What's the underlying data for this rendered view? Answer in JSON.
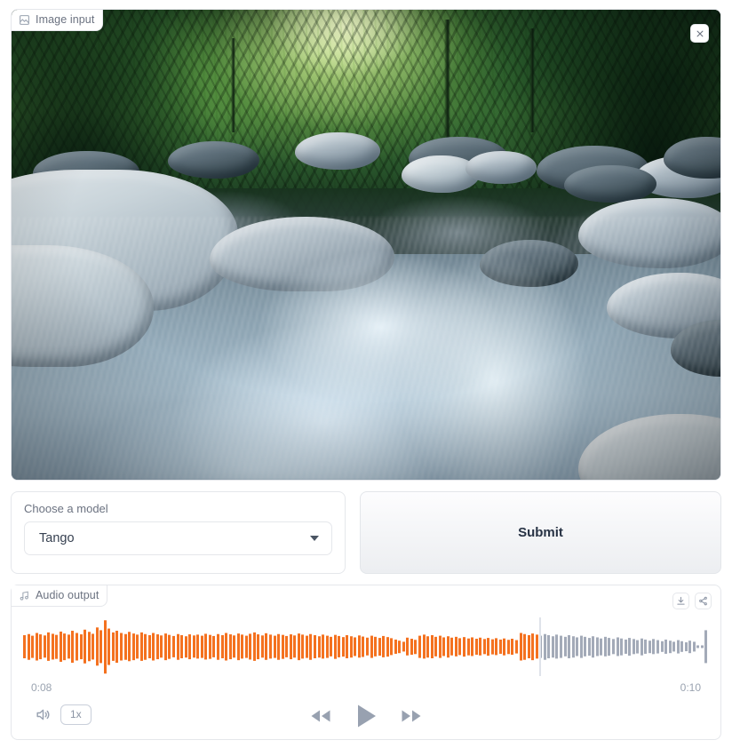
{
  "image_input": {
    "label": "Image input",
    "icon": "image-icon",
    "close_icon": "close-icon",
    "photo_description": "Long-exposure photograph of a mountain stream flowing over blue-gray boulders with a bright green forest canopy above"
  },
  "model_selector": {
    "label": "Choose a model",
    "value": "Tango",
    "caret_icon": "chevron-down-icon"
  },
  "submit": {
    "label": "Submit"
  },
  "audio_output": {
    "label": "Audio output",
    "icon": "music-note-icon",
    "download_icon": "download-icon",
    "share_icon": "share-icon",
    "current_time": "0:08",
    "total_time": "0:10",
    "volume_icon": "volume-icon",
    "speed_label": "1x",
    "rewind_icon": "rewind-icon",
    "play_icon": "play-icon",
    "forward_icon": "fast-forward-icon",
    "progress_ratio": 0.755,
    "played_color": "#f4711f",
    "remaining_color": "#a3aab8",
    "playhead_color": "#dfe3ea",
    "waveform_heights": [
      0.42,
      0.46,
      0.4,
      0.5,
      0.45,
      0.41,
      0.52,
      0.47,
      0.43,
      0.55,
      0.48,
      0.44,
      0.58,
      0.5,
      0.45,
      0.62,
      0.54,
      0.47,
      0.7,
      0.6,
      0.96,
      0.66,
      0.52,
      0.58,
      0.5,
      0.46,
      0.54,
      0.48,
      0.44,
      0.52,
      0.46,
      0.42,
      0.5,
      0.45,
      0.41,
      0.48,
      0.43,
      0.39,
      0.46,
      0.42,
      0.38,
      0.45,
      0.41,
      0.44,
      0.4,
      0.47,
      0.43,
      0.39,
      0.46,
      0.42,
      0.5,
      0.45,
      0.41,
      0.48,
      0.44,
      0.4,
      0.47,
      0.52,
      0.45,
      0.41,
      0.49,
      0.44,
      0.4,
      0.46,
      0.43,
      0.39,
      0.45,
      0.41,
      0.48,
      0.44,
      0.4,
      0.46,
      0.42,
      0.38,
      0.44,
      0.4,
      0.36,
      0.43,
      0.39,
      0.35,
      0.42,
      0.38,
      0.34,
      0.41,
      0.37,
      0.33,
      0.4,
      0.36,
      0.32,
      0.39,
      0.35,
      0.31,
      0.26,
      0.22,
      0.18,
      0.33,
      0.29,
      0.25,
      0.4,
      0.44,
      0.38,
      0.42,
      0.36,
      0.4,
      0.34,
      0.38,
      0.33,
      0.36,
      0.31,
      0.35,
      0.3,
      0.34,
      0.29,
      0.33,
      0.28,
      0.32,
      0.27,
      0.31,
      0.26,
      0.3,
      0.25,
      0.29,
      0.24,
      0.5,
      0.46,
      0.42,
      0.48,
      0.44,
      0.4,
      0.46,
      0.42,
      0.38,
      0.44,
      0.4,
      0.36,
      0.42,
      0.38,
      0.34,
      0.4,
      0.36,
      0.32,
      0.38,
      0.34,
      0.3,
      0.36,
      0.32,
      0.28,
      0.34,
      0.3,
      0.26,
      0.32,
      0.28,
      0.24,
      0.3,
      0.26,
      0.22,
      0.28,
      0.24,
      0.2,
      0.26,
      0.22,
      0.18,
      0.24,
      0.2,
      0.16,
      0.22,
      0.18,
      0.05,
      0.05,
      0.6
    ]
  }
}
